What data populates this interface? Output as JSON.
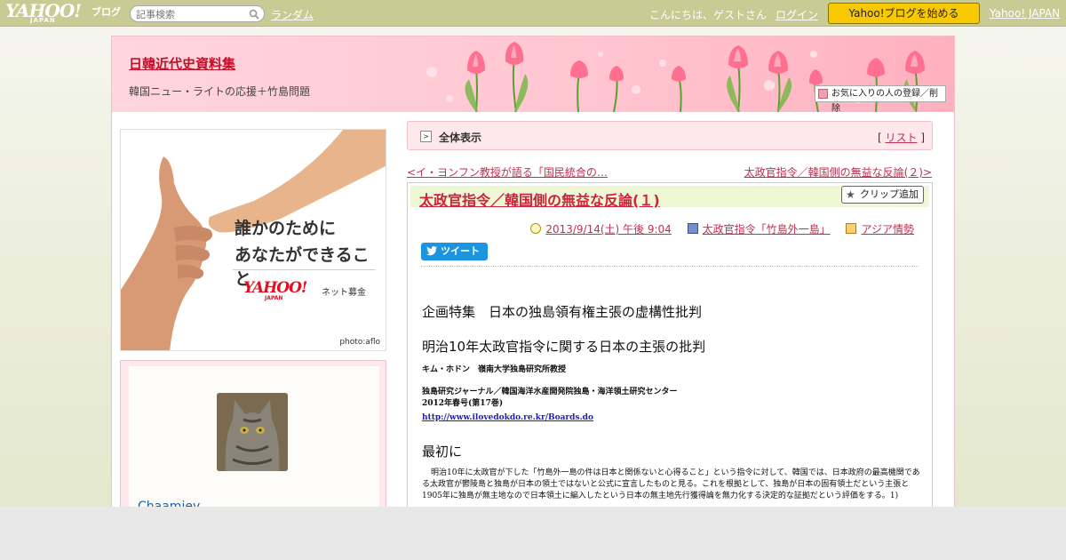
{
  "topbar": {
    "logo_text": "YAHOO!",
    "logo_sub": "JAPAN",
    "logo_blog": "ブログ",
    "search_placeholder": "記事検索",
    "random_label": "ランダム",
    "greeting": "こんにちは、ゲストさん",
    "login_label": "ログイン",
    "start_label": "Yahoo!ブログを始める",
    "yahoo_japan_label": "Yahoo! JAPAN"
  },
  "header": {
    "blog_title": "日韓近代史資料集",
    "blog_desc": "韓国ニュー・ライトの応援＋竹島問題",
    "fav_label": "お気に入りの人の登録／削除"
  },
  "ad": {
    "line1": "誰かのために",
    "line2": "あなたができること",
    "logo_text": "YAHOO!",
    "logo_sub": "JAPAN",
    "net_label": "ネット募金",
    "credit": "photo:aflo"
  },
  "profile": {
    "nickname": "Chaamiey"
  },
  "main_bar": {
    "label": "全体表示",
    "list_open": "[ ",
    "list_label": "リスト",
    "list_close": " ]"
  },
  "nav": {
    "prev_label": "<イ・ヨンフン教授が語る「国民統合の…",
    "next_label": "太政官指令／韓国側の無益な反論(２)>"
  },
  "article": {
    "title": "太政官指令／韓国側の無益な反論(１)",
    "clip_label": "クリップ追加",
    "date": "2013/9/14(土) 午後 9:04",
    "category": "太政官指令「竹島外一島」",
    "folder": "アジア情勢",
    "tweet_label": "ツイート",
    "heading1": "企画特集　日本の独島領有権主張の虚構性批判",
    "heading2": "明治10年太政官指令に関する日本の主張の批判",
    "author": "キム・ホドン　嶺南大学独島研究所教授",
    "source1": "独島研究ジャーナル／韓国海洋水産開発院独島・海洋領土研究センター",
    "source2": "2012年春号(第17巻)",
    "source_url": "http://www.ilovedokdo.re.kr/Boards.do",
    "heading3": "最初に",
    "paragraph": "明治10年に太政官が下した「竹島外一島の件は日本と関係ないと心得ること」という指令に対して、韓国では、日本政府の最高機関である太政官が鬱陵島と独島が日本の領土ではないと公式に宣言したものと見る。これを根拠として、独島が日本の固有領土だという主張と1905年に独島が無主地なので日本領土に編入したという日本の無主地先行獲得論を無力化する決定的な証拠だという評価をする。1)"
  }
}
